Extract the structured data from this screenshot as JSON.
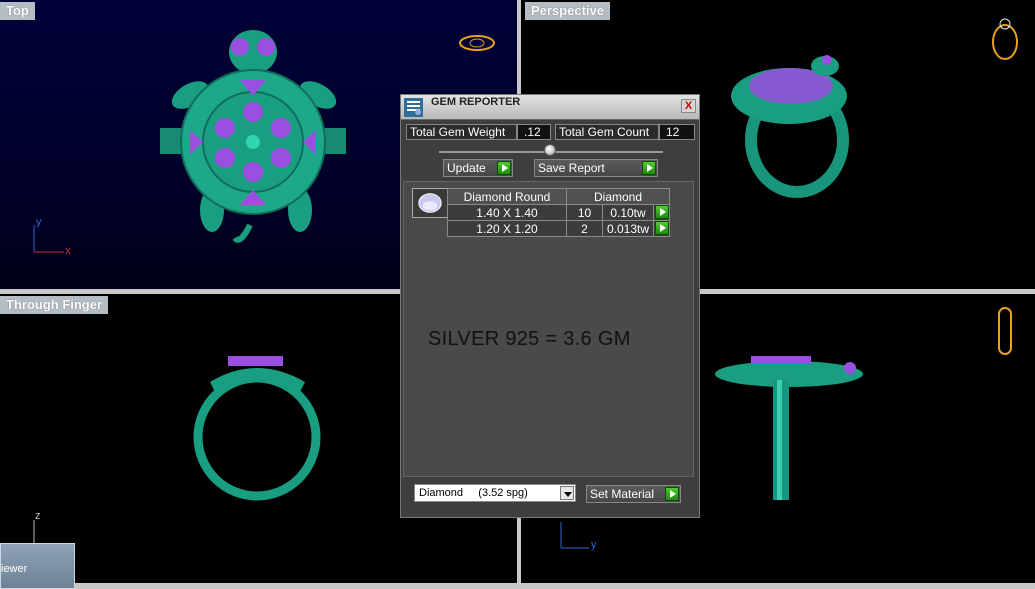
{
  "viewports": {
    "top": {
      "label": "Top",
      "axis_y": "y",
      "axis_x": "x"
    },
    "perspective": {
      "label": "Perspective"
    },
    "through_finger": {
      "label": "Through Finger",
      "axis_z": "z"
    },
    "side": {
      "axis_y": "y"
    }
  },
  "viewer_tab": {
    "label": "iewer"
  },
  "dialog": {
    "title": "GEM REPORTER",
    "close_label": "X",
    "total_gem_weight_label": "Total Gem Weight",
    "total_gem_weight_value": ".12",
    "total_gem_count_label": "Total Gem Count",
    "total_gem_count_value": "12",
    "update_label": "Update",
    "save_report_label": "Save Report",
    "table": {
      "header_shape": "Diamond Round",
      "header_material": "Diamond",
      "rows": [
        {
          "size": "1.40 X 1.40",
          "count": "10",
          "weight": "0.10tw"
        },
        {
          "size": "1.20 X 1.20",
          "count": "2",
          "weight": "0.013tw"
        }
      ]
    },
    "note": "SILVER 925 = 3.6 GM",
    "material_select": "Diamond     (3.52 spg)",
    "set_material_label": "Set Material"
  },
  "colors": {
    "ring_green": "#1a9e82",
    "gem_purple": "#9a4fe0",
    "accent_green": "#3cb521"
  }
}
